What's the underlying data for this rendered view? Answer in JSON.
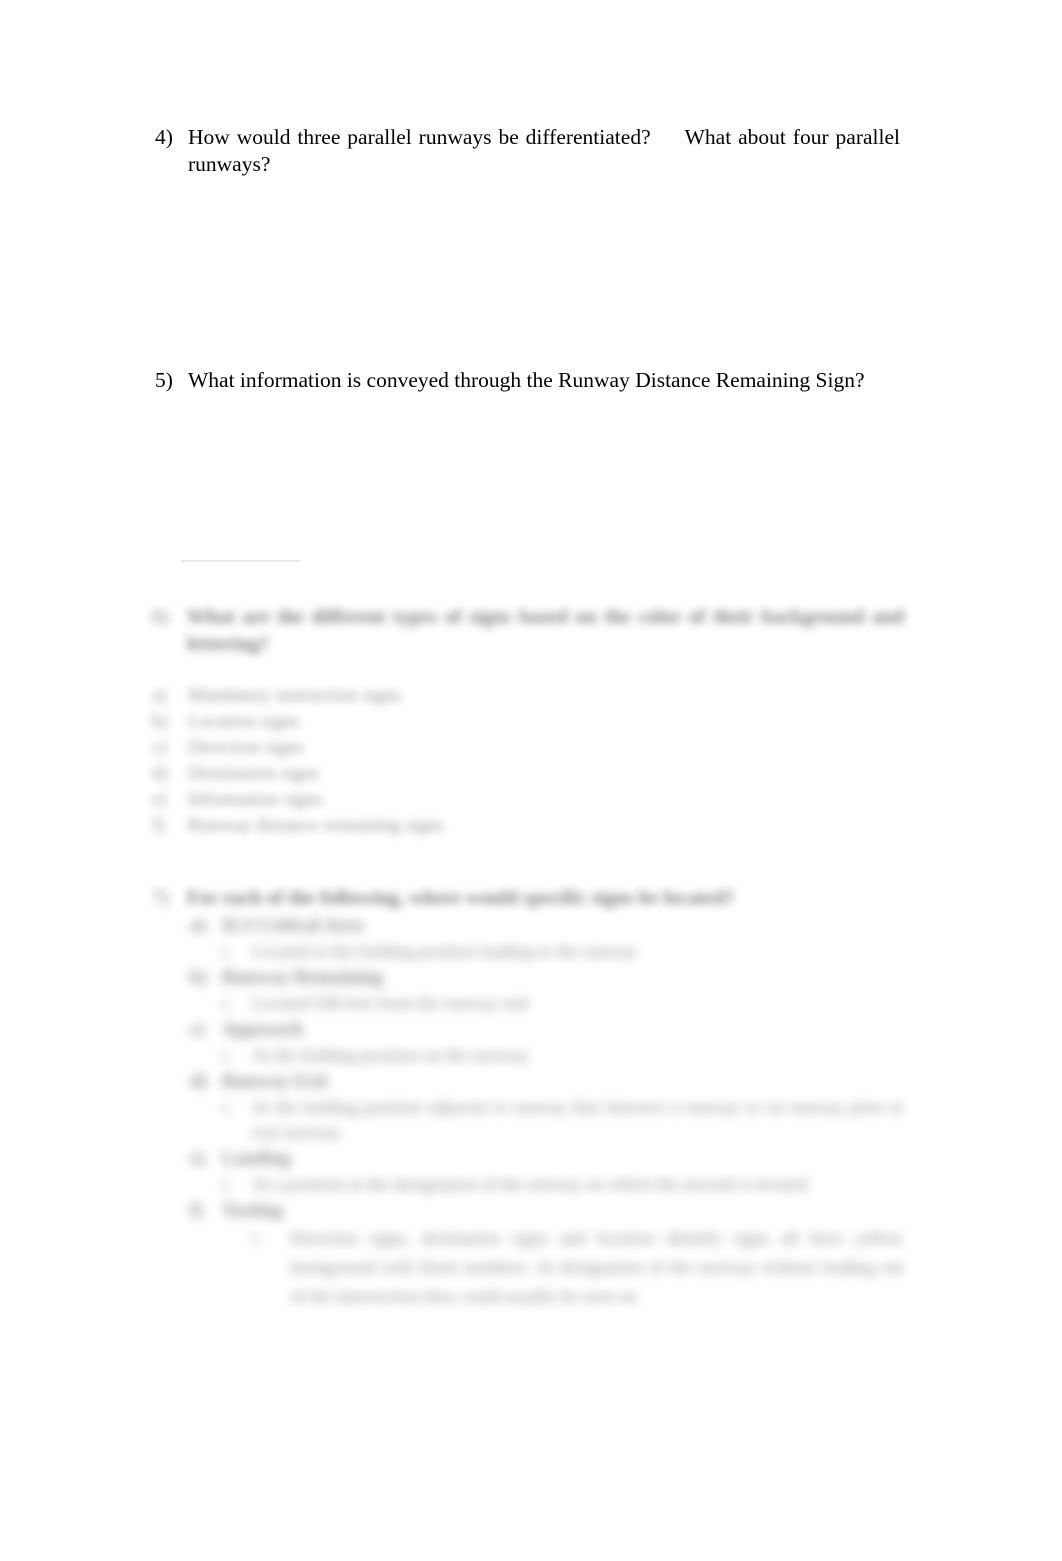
{
  "document": {
    "questions": [
      {
        "number": "4)",
        "text_part_1": "How would three parallel runways be differentiated?",
        "text_part_2": "What about four parallel runways?"
      },
      {
        "number": "5)",
        "text": "What information is conveyed through the Runway Distance Remaining Sign?"
      }
    ],
    "question6": {
      "number": "6)",
      "heading": "What are the different types of signs based on the color of their background and lettering?",
      "items": [
        {
          "marker": "a)",
          "label": "Mandatory instruction signs"
        },
        {
          "marker": "b)",
          "label": "Location signs"
        },
        {
          "marker": "c)",
          "label": "Direction signs"
        },
        {
          "marker": "d)",
          "label": "Destination signs"
        },
        {
          "marker": "e)",
          "label": "Information signs"
        },
        {
          "marker": "f)",
          "label": "Runway distance remaining signs"
        }
      ]
    },
    "question7": {
      "number": "7)",
      "heading": "For each of the following, where would specific signs be located?",
      "items": [
        {
          "marker": "a)",
          "title": "ILS Critical Area",
          "detail_marker": "i.",
          "detail": "Located at the holding position leading to the runway"
        },
        {
          "marker": "b)",
          "title": "Runway Remaining",
          "detail_marker": "i.",
          "detail": "Located 500 feet from the runway end"
        },
        {
          "marker": "c)",
          "title": "Approach",
          "detail_marker": "i.",
          "detail": "At the holding position on the taxiway"
        },
        {
          "marker": "d)",
          "title": "Runway Exit",
          "detail_marker": "i.",
          "detail": "At the holding position adjacent to runway that intersect a runway or on runway prior to exit taxiway"
        },
        {
          "marker": "e)",
          "title": "Landing",
          "detail_marker": "i.",
          "detail": "At a position at the designation of the runway on which the aircraft is located"
        },
        {
          "marker": "f)",
          "title": "Taxiing",
          "detail_marker": "i.",
          "detail": "Direction signs, destination signs and location identify signs all have yellow background with black numbers. At designation of the taxiway without leading out of the intersection they could usually be seen on"
        }
      ]
    }
  }
}
